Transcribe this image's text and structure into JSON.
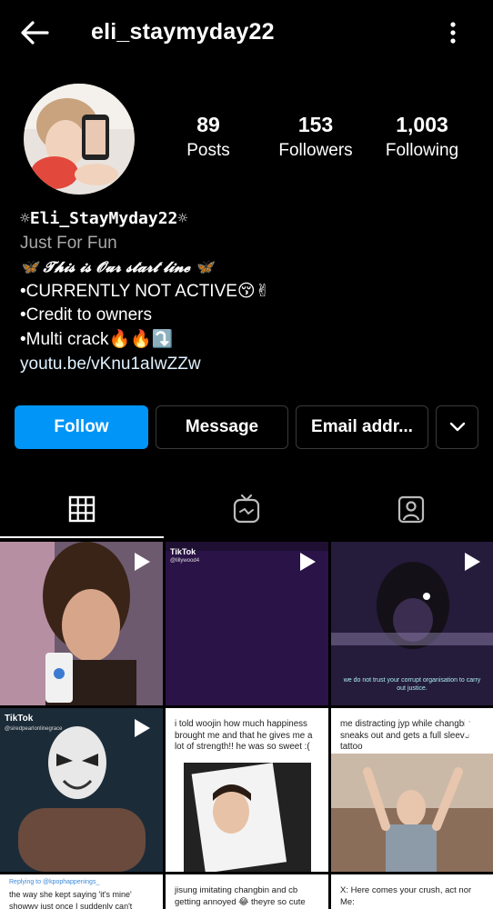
{
  "header": {
    "username": "eli_staymyday22"
  },
  "stats": {
    "posts_count": "89",
    "posts_label": "Posts",
    "followers_count": "153",
    "followers_label": "Followers",
    "following_count": "1,003",
    "following_label": "Following"
  },
  "bio": {
    "display_name": "☼Eli_StayMyday22☼",
    "category": "Just For Fun",
    "line1": "🦋 𝓣𝓱𝓲𝓼 𝓲𝓼 𝓞𝓾𝓻 𝓼𝓽𝓪𝓻𝓽 𝓵𝓲𝓷𝓮 🦋",
    "line2": "•CURRENTLY NOT ACTIVE😚✌",
    "line3": "•Credit to owners",
    "line4": "•Multi crack🔥🔥⤵️",
    "link": "youtu.be/vKnu1aIwZZw"
  },
  "actions": {
    "follow": "Follow",
    "message": "Message",
    "email": "Email addr..."
  },
  "grid": {
    "tile2_tiktok": "TikTok",
    "tile2_sub": "@lillywood4",
    "tile3_caption": "we do not trust your corrupt organisation to carry out justice.",
    "tile4_tiktok": "TikTok",
    "tile4_sub": "@siredpearlonlinegrace",
    "tile5_text": "i told woojin how much happiness brought me and that he gives me a lot of strength!! he was so sweet :(",
    "tile6_text": "me distracting jyp while changbin sneaks out and gets a full sleeve tattoo",
    "tile7_reply": "Replying to @kpophappenings_",
    "tile7_text": "the way she kept saying 'it's mine' showwy just once I suddenly can't",
    "tile8_text": "jisung imitating changbin and cb getting annoyed 😂 theyre so cute",
    "tile9_text": "X: Here comes your crush, act nor Me:"
  },
  "colors": {
    "follow_button": "#0095f6",
    "link": "#e0f1ff",
    "category": "#a8a8a8",
    "background": "#000000"
  },
  "icons": [
    "back-arrow-icon",
    "more-vertical-icon",
    "chevron-down-icon",
    "grid-icon",
    "igtv-icon",
    "tagged-user-icon",
    "play-icon"
  ]
}
